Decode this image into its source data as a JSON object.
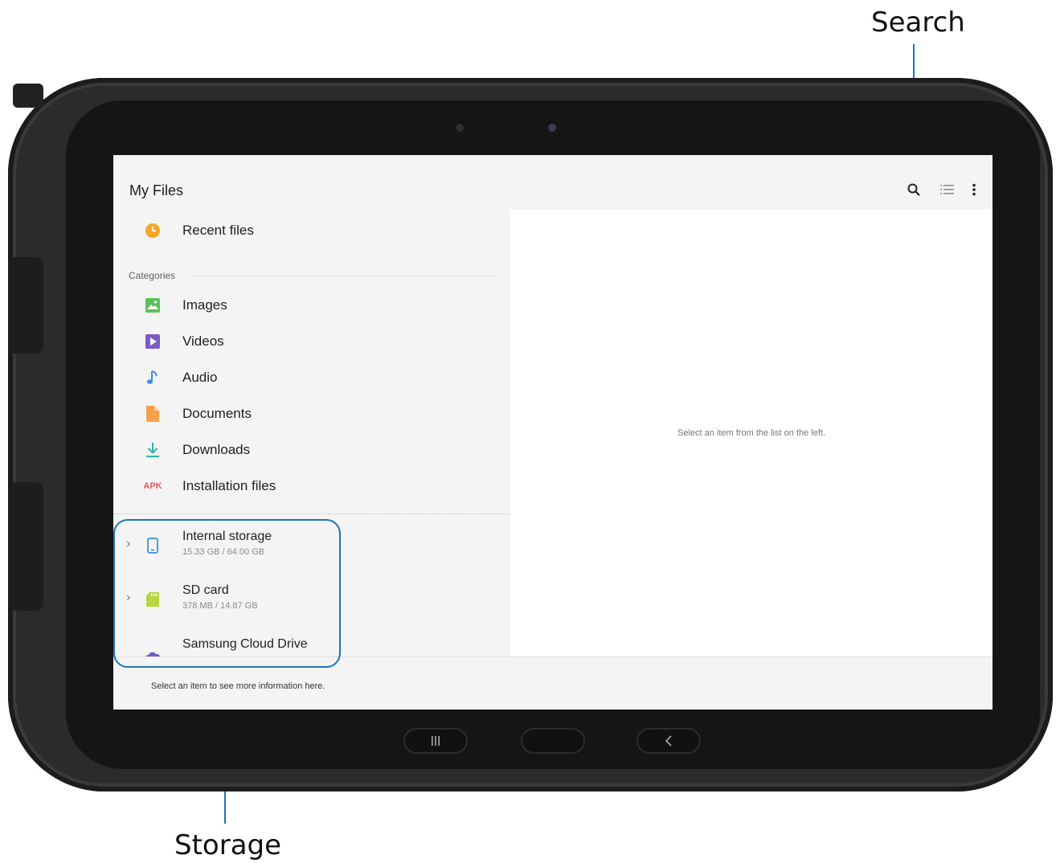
{
  "callouts": {
    "search": "Search",
    "storage": "Storage"
  },
  "app": {
    "title": "My Files",
    "toolbar_icons": [
      "search-icon",
      "list-view-icon",
      "more-options-icon"
    ]
  },
  "sidebar": {
    "recent": {
      "label": "Recent files",
      "icon": "clock-icon",
      "color": "#f5a623"
    },
    "categories_heading": "Categories",
    "categories": [
      {
        "label": "Images",
        "icon": "image-icon",
        "color": "#5cc15c"
      },
      {
        "label": "Videos",
        "icon": "video-icon",
        "color": "#7b5cc6"
      },
      {
        "label": "Audio",
        "icon": "music-note-icon",
        "color": "#3a8fe0"
      },
      {
        "label": "Documents",
        "icon": "document-icon",
        "color": "#f6a04a"
      },
      {
        "label": "Downloads",
        "icon": "download-icon",
        "color": "#2ab3a6"
      },
      {
        "label": "Installation files",
        "icon": "apk-icon",
        "icon_text": "APK",
        "color": "#f2555a"
      }
    ],
    "storage": [
      {
        "label": "Internal storage",
        "detail": "15.33 GB / 64.00 GB",
        "icon": "phone-icon",
        "expandable": true
      },
      {
        "label": "SD card",
        "detail": "378 MB / 14.87 GB",
        "icon": "sd-card-icon",
        "expandable": true
      },
      {
        "label": "Samsung Cloud Drive",
        "icon": "cloud-drive-icon",
        "expandable": false
      }
    ]
  },
  "main": {
    "empty_message": "Select an item from the list on the left."
  },
  "footer": {
    "message": "Select an item to see more information here."
  },
  "accent_color": "#1a74b8"
}
